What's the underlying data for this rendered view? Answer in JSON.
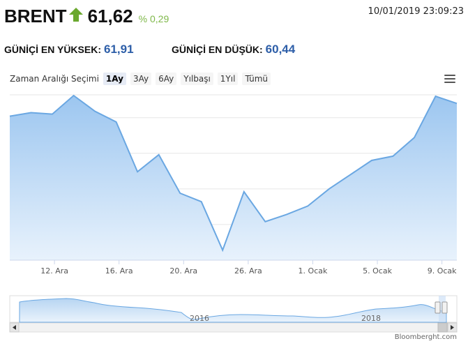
{
  "header": {
    "symbol": "BRENT",
    "price": "61,62",
    "change": "% 0,29",
    "datetime": "10/01/2019 23:09:23"
  },
  "daily": {
    "high_label": "GÜNİÇİ EN YÜKSEK:",
    "high_value": "61,91",
    "low_label": "GÜNİÇİ EN DÜŞÜK:",
    "low_value": "60,44"
  },
  "range_selector": {
    "label": "Zaman Aralığı Seçimi",
    "buttons": [
      "1Ay",
      "3Ay",
      "6Ay",
      "Yılbaşı",
      "1Yıl",
      "Tümü"
    ],
    "selected": "1Ay"
  },
  "menu_icon": "hamburger-icon",
  "credit": "Bloomberght.com",
  "colors": {
    "accent_blue": "#2d5ea8",
    "up_green": "#6aa82e",
    "line": "#6aa7e2",
    "fill": "#a9cdf2"
  },
  "chart_data": {
    "type": "area",
    "title": "",
    "y_ticks": [
      "50",
      "52.5",
      "55",
      "57.5",
      "60"
    ],
    "ylim": [
      50,
      61.6
    ],
    "grid": true,
    "x_tick_labels": [
      "12. Ara",
      "16. Ara",
      "20. Ara",
      "26. Ara",
      "1. Ocak",
      "5. Ocak",
      "9. Ocak"
    ],
    "values": [
      60.1,
      60.35,
      60.25,
      61.55,
      60.45,
      59.7,
      56.2,
      57.4,
      54.7,
      54.1,
      50.7,
      54.8,
      52.7,
      53.2,
      53.8,
      55.0,
      56.0,
      57.0,
      57.3,
      58.6,
      61.5,
      61.0
    ],
    "navigator": {
      "x_labels": [
        "2016",
        "2018"
      ]
    }
  }
}
